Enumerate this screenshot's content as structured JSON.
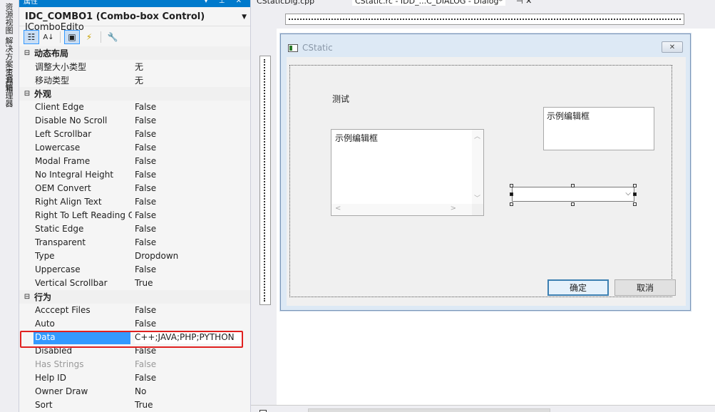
{
  "left_strip": {
    "tabs": [
      "资源视图 解决方案资源管理器",
      "工具箱"
    ]
  },
  "properties_panel": {
    "title": "属性",
    "title_buttons": "▾ ⊥ ✕",
    "object_name": "IDC_COMBO1 (Combo-box Control)",
    "object_type": "IComboEdito",
    "categories": [
      {
        "name": "动态布局",
        "items": [
          {
            "name": "调整大小类型",
            "value": "无"
          },
          {
            "name": "移动类型",
            "value": "无"
          }
        ]
      },
      {
        "name": "外观",
        "items": [
          {
            "name": "Client Edge",
            "value": "False"
          },
          {
            "name": "Disable No Scroll",
            "value": "False"
          },
          {
            "name": "Left Scrollbar",
            "value": "False"
          },
          {
            "name": "Lowercase",
            "value": "False"
          },
          {
            "name": "Modal Frame",
            "value": "False"
          },
          {
            "name": "No Integral Height",
            "value": "False"
          },
          {
            "name": "OEM Convert",
            "value": "False"
          },
          {
            "name": "Right Align Text",
            "value": "False"
          },
          {
            "name": "Right To Left Reading Order",
            "value": "False"
          },
          {
            "name": "Static Edge",
            "value": "False"
          },
          {
            "name": "Transparent",
            "value": "False"
          },
          {
            "name": "Type",
            "value": "Dropdown"
          },
          {
            "name": "Uppercase",
            "value": "False"
          },
          {
            "name": "Vertical Scrollbar",
            "value": "True"
          }
        ]
      },
      {
        "name": "行为",
        "items": [
          {
            "name": "Acccept Files",
            "value": "False"
          },
          {
            "name": "Auto",
            "value": "False"
          },
          {
            "name": "Data",
            "value": "C++;JAVA;PHP;PYTHON",
            "selected": true
          },
          {
            "name": "Disabled",
            "value": "False"
          },
          {
            "name": "Has Strings",
            "value": "False",
            "dim": true
          },
          {
            "name": "Help ID",
            "value": "False"
          },
          {
            "name": "Owner Draw",
            "value": "No"
          },
          {
            "name": "Sort",
            "value": "True"
          }
        ]
      }
    ]
  },
  "tabs": [
    {
      "label": "CStaticDlg.cpp",
      "active": false
    },
    {
      "label": "CStatic.rc - IDD_...C_DIALOG - Dialog*",
      "active": true
    }
  ],
  "tab_buttons": "⊣ ✕",
  "dialog": {
    "title": "CStatic",
    "static_text": "测试",
    "edit1_text": "示例编辑框",
    "edit2_text": "示例编辑框",
    "ok_label": "确定",
    "cancel_label": "取消"
  },
  "colors": {
    "accent": "#007acc",
    "selection": "#3399ff",
    "highlight_border": "#e0201f"
  },
  "icons": [
    "categorized-icon",
    "alphabetical-icon",
    "properties-icon",
    "events-icon",
    "property-pages-icon"
  ]
}
